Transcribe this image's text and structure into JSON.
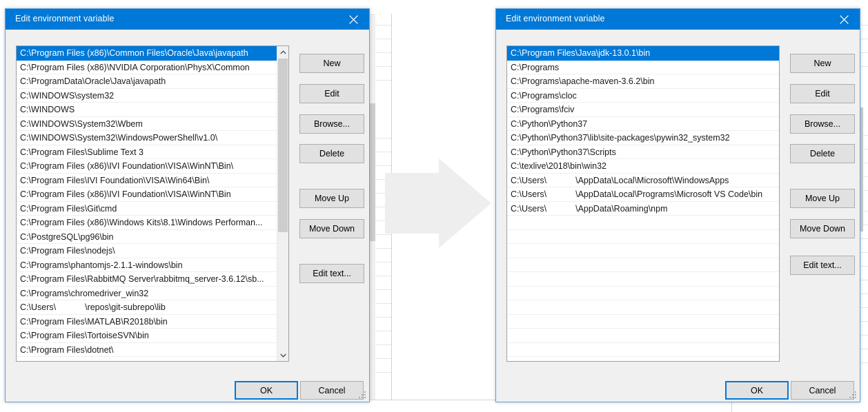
{
  "arrow": {
    "name": "right-arrow",
    "color": "#eeeeee"
  },
  "colors": {
    "title_bar": "#0078d7",
    "selection": "#0078d7",
    "dialog_face": "#f0f0f0",
    "button_face": "#e1e1e1",
    "button_border": "#adadad",
    "focus_border": "#0078d7",
    "list_background": "#ffffff"
  },
  "left_dialog": {
    "title": "Edit environment variable",
    "close_label": "✕",
    "buttons": {
      "new": "New",
      "edit": "Edit",
      "browse": "Browse...",
      "delete": "Delete",
      "move_up": "Move Up",
      "move_down": "Move Down",
      "edit_text": "Edit text...",
      "ok": "OK",
      "cancel": "Cancel"
    },
    "selected_index": 0,
    "scrollbar": {
      "up_arrow": "⌃",
      "down_arrow": "⌄"
    },
    "paths": [
      "C:\\Program Files (x86)\\Common Files\\Oracle\\Java\\javapath",
      "C:\\Program Files (x86)\\NVIDIA Corporation\\PhysX\\Common",
      "C:\\ProgramData\\Oracle\\Java\\javapath",
      "C:\\WINDOWS\\system32",
      "C:\\WINDOWS",
      "C:\\WINDOWS\\System32\\Wbem",
      "C:\\WINDOWS\\System32\\WindowsPowerShell\\v1.0\\",
      "C:\\Program Files\\Sublime Text 3",
      "C:\\Program Files (x86)\\IVI Foundation\\VISA\\WinNT\\Bin\\",
      "C:\\Program Files\\IVI Foundation\\VISA\\Win64\\Bin\\",
      "C:\\Program Files (x86)\\IVI Foundation\\VISA\\WinNT\\Bin",
      "C:\\Program Files\\Git\\cmd",
      "C:\\Program Files (x86)\\Windows Kits\\8.1\\Windows Performan...",
      "C:\\PostgreSQL\\pg96\\bin",
      "C:\\Program Files\\nodejs\\",
      "C:\\Programs\\phantomjs-2.1.1-windows\\bin",
      "C:\\Program Files\\RabbitMQ Server\\rabbitmq_server-3.6.12\\sb...",
      "C:\\Programs\\chromedriver_win32",
      "C:\\Users\\",
      "C:\\Program Files\\MATLAB\\R2018b\\bin",
      "C:\\Program Files\\TortoiseSVN\\bin",
      "C:\\Program Files\\dotnet\\"
    ],
    "redacted_row": {
      "index": 18,
      "prefix": "C:\\Users\\",
      "suffix": "\\repos\\git-subrepo\\lib"
    }
  },
  "right_dialog": {
    "title": "Edit environment variable",
    "close_label": "✕",
    "buttons": {
      "new": "New",
      "edit": "Edit",
      "browse": "Browse...",
      "delete": "Delete",
      "move_up": "Move Up",
      "move_down": "Move Down",
      "edit_text": "Edit text...",
      "ok": "OK",
      "cancel": "Cancel"
    },
    "selected_index": 0,
    "paths": [
      "C:\\Program Files\\Java\\jdk-13.0.1\\bin",
      "C:\\Programs",
      "C:\\Programs\\apache-maven-3.6.2\\bin",
      "C:\\Programs\\cloc",
      "C:\\Programs\\fciv",
      "C:\\Python\\Python37",
      "C:\\Python\\Python37\\lib\\site-packages\\pywin32_system32",
      "C:\\Python\\Python37\\Scripts",
      "C:\\texlive\\2018\\bin\\win32",
      "C:\\Users\\",
      "C:\\Users\\",
      "C:\\Users\\"
    ],
    "redacted_rows": [
      {
        "index": 9,
        "prefix": "C:\\Users\\",
        "suffix": "\\AppData\\Local\\Microsoft\\WindowsApps"
      },
      {
        "index": 10,
        "prefix": "C:\\Users\\",
        "suffix": "\\AppData\\Local\\Programs\\Microsoft VS Code\\bin"
      },
      {
        "index": 11,
        "prefix": "C:\\Users\\",
        "suffix": "\\AppData\\Roaming\\npm"
      }
    ],
    "empty_row_count": 10
  }
}
